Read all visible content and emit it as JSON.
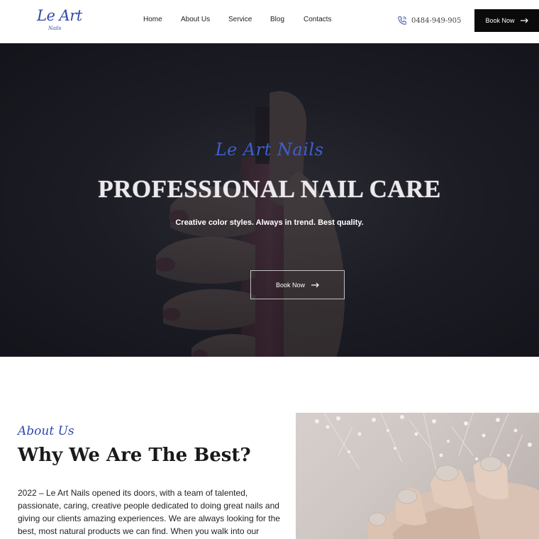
{
  "header": {
    "logo_main": "Le Art",
    "logo_sub": "Nails",
    "nav": [
      "Home",
      "About Us",
      "Service",
      "Blog",
      "Contacts"
    ],
    "phone": "0484-949-905",
    "book_label": "Book Now"
  },
  "hero": {
    "script": "Le Art Nails",
    "title": "PROFESSIONAL NAIL CARE",
    "subtitle": "Creative color styles. Always in trend. Best quality.",
    "book_label": "Book Now"
  },
  "about": {
    "script": "About Us",
    "title": "Why We Are The Best?",
    "text": "2022 – Le Art Nails opened its doors, with a team of talented, passionate, caring, creative people dedicated to doing great nails and giving our clients amazing experiences. We are always looking for the best, most natural products we can find. When you walk into our"
  },
  "colors": {
    "accent": "#2f4aa8",
    "dark": "#0a0a0a"
  },
  "icons": {
    "phone": "phone-icon",
    "arrow": "arrow-right-icon"
  }
}
